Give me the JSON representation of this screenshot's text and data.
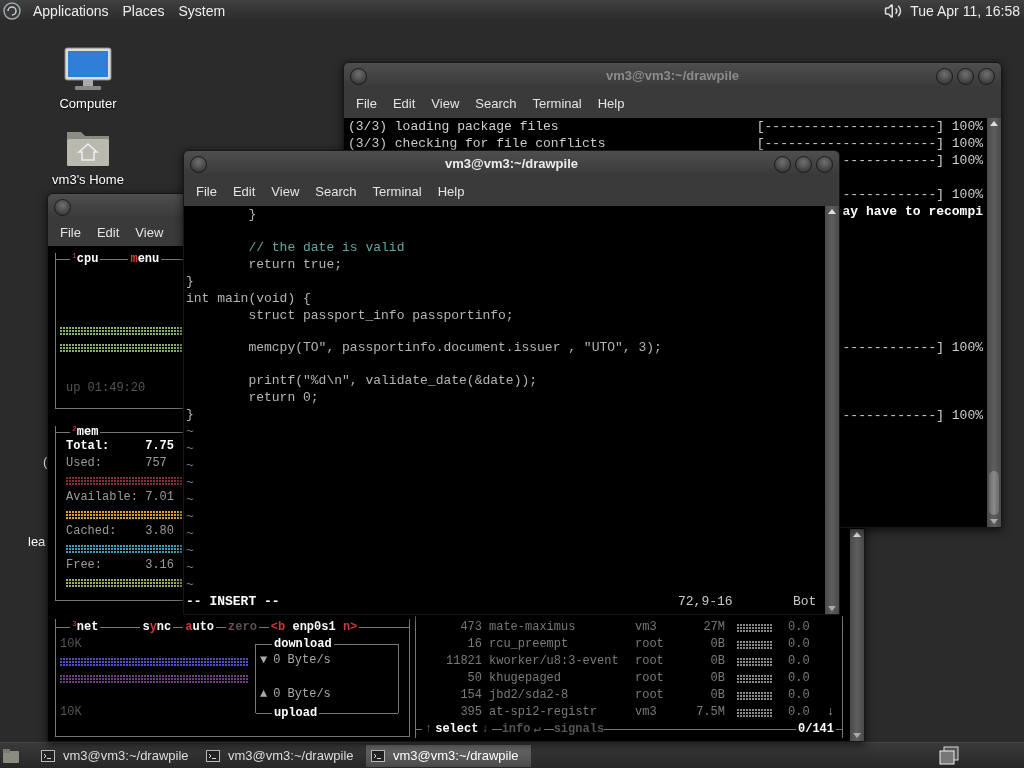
{
  "top_panel": {
    "menus": [
      "Applications",
      "Places",
      "System"
    ],
    "clock": "Tue Apr 11, 16:58"
  },
  "desktop": {
    "icons": [
      {
        "kind": "computer",
        "label": "Computer"
      },
      {
        "kind": "home",
        "label": "vm3's Home"
      }
    ],
    "partial_labels": [
      "(",
      "lea"
    ]
  },
  "btop_window": {
    "menu": [
      "File",
      "Edit",
      "View"
    ],
    "cpu_box": {
      "number": "1",
      "title": "cpu",
      "menu_segments": [
        {
          "kind": "key",
          "text": "m"
        },
        {
          "kind": "plain",
          "text": "enu"
        }
      ],
      "uptime": "up 01:49:20"
    },
    "mem_box": {
      "number": "2",
      "title": "mem",
      "rows": [
        {
          "kind": "total",
          "text": "Total:     7.75"
        },
        {
          "kind": "value",
          "text": "Used:      757"
        },
        {
          "kind": "bar",
          "color": "#7c3434"
        },
        {
          "kind": "value",
          "text": "Available: 7.01"
        },
        {
          "kind": "bar",
          "color": "#d8a630"
        },
        {
          "kind": "value",
          "text": "Cached:    3.80"
        },
        {
          "kind": "bar",
          "color": "#3f9fc0"
        },
        {
          "kind": "value",
          "text": "Free:      3.16"
        },
        {
          "kind": "bar",
          "color": "#9ab060"
        }
      ]
    },
    "net_box": {
      "number": "3",
      "title": "net",
      "options": [
        {
          "disabled": false,
          "segments": [
            {
              "kind": "plain",
              "text": "s"
            },
            {
              "kind": "key",
              "text": "y"
            },
            {
              "kind": "plain",
              "text": "nc"
            }
          ]
        },
        {
          "disabled": false,
          "segments": [
            {
              "kind": "key",
              "text": "a"
            },
            {
              "kind": "plain",
              "text": "uto"
            }
          ]
        },
        {
          "disabled": true,
          "segments": [
            {
              "kind": "key",
              "text": "z"
            },
            {
              "kind": "plain",
              "text": "ero"
            }
          ]
        },
        {
          "disabled": false,
          "segments": [
            {
              "kind": "key",
              "text": "<b"
            },
            {
              "kind": "plain",
              "text": " enp0s1 "
            },
            {
              "kind": "key",
              "text": "n>"
            }
          ]
        }
      ],
      "scale_top": "10K",
      "scale_bottom": "10K",
      "download": {
        "title": "download",
        "arrow": "▼",
        "rate": "0 Byte/s"
      },
      "upload": {
        "title": "upload",
        "arrow": "▲",
        "rate": "0 Byte/s"
      }
    },
    "proc_box": {
      "rows": [
        {
          "pid": "473",
          "name": "mate-maximus",
          "user": "vm3",
          "mem": "27M",
          "cpu": "0.0"
        },
        {
          "pid": "16",
          "name": "rcu_preempt",
          "user": "root",
          "mem": "0B",
          "cpu": "0.0"
        },
        {
          "pid": "11821",
          "name": "kworker/u8:3-event",
          "user": "root",
          "mem": "0B",
          "cpu": "0.0"
        },
        {
          "pid": "50",
          "name": "khugepaged",
          "user": "root",
          "mem": "0B",
          "cpu": "0.0"
        },
        {
          "pid": "154",
          "name": "jbd2/sda2-8",
          "user": "root",
          "mem": "0B",
          "cpu": "0.0"
        },
        {
          "pid": "395",
          "name": "at-spi2-registr",
          "user": "vm3",
          "mem": "7.5M",
          "cpu": "0.0"
        }
      ],
      "scroll_marker": "↓",
      "footer": [
        {
          "kind": "arrow",
          "text": "↑"
        },
        {
          "kind": "label",
          "text": "select"
        },
        {
          "kind": "arrow",
          "text": "↓"
        },
        {
          "kind": "gap"
        },
        {
          "kind": "dim",
          "text": "info"
        },
        {
          "kind": "arrow",
          "text": "↵"
        },
        {
          "kind": "gap"
        },
        {
          "kind": "dim",
          "text": "signals"
        }
      ],
      "count": "0/141"
    }
  },
  "back_terminal": {
    "title": "vm3@vm3:~/drawpile",
    "active": false,
    "menu": [
      "File",
      "Edit",
      "View",
      "Search",
      "Terminal",
      "Help"
    ],
    "lines": [
      {
        "text": "(3/3) loading package files",
        "progress": "[----------------------] 100%"
      },
      {
        "text": "(3/3) checking for file conflicts",
        "progress": "[----------------------] 100%"
      }
    ],
    "tail": [
      {
        "kind": "progress",
        "text": "------------] 100%"
      },
      {
        "kind": "blank"
      },
      {
        "kind": "progress",
        "text": "------------] 100%"
      },
      {
        "kind": "bold",
        "text": "ay have to recompi"
      },
      {
        "kind": "blank"
      },
      {
        "kind": "blank"
      },
      {
        "kind": "blank"
      },
      {
        "kind": "blank"
      },
      {
        "kind": "blank"
      },
      {
        "kind": "blank"
      },
      {
        "kind": "blank"
      },
      {
        "kind": "progress",
        "text": "------------] 100%"
      },
      {
        "kind": "blank"
      },
      {
        "kind": "blank"
      },
      {
        "kind": "blank"
      },
      {
        "kind": "progress",
        "text": "------------] 100%"
      }
    ]
  },
  "front_terminal": {
    "title": "vm3@vm3:~/drawpile",
    "active": true,
    "menu": [
      "File",
      "Edit",
      "View",
      "Search",
      "Terminal",
      "Help"
    ],
    "lines": [
      {
        "kind": "code",
        "text": "        }"
      },
      {
        "kind": "blank"
      },
      {
        "kind": "comment",
        "text": "        // the date is valid"
      },
      {
        "kind": "code",
        "text": "        return true;"
      },
      {
        "kind": "code",
        "text": "}"
      },
      {
        "kind": "code",
        "text": "int main(void) {"
      },
      {
        "kind": "code",
        "text": "        struct passport_info passportinfo;"
      },
      {
        "kind": "blank"
      },
      {
        "kind": "code",
        "text": "        memcpy(TO\", passportinfo.document.issuer , \"UTO\", 3);"
      },
      {
        "kind": "blank"
      },
      {
        "kind": "code",
        "text": "        printf(\"%d\\n\", validate_date(&date));"
      },
      {
        "kind": "code",
        "text": "        return 0;"
      },
      {
        "kind": "code",
        "text": "}"
      },
      {
        "kind": "tilde",
        "text": "~"
      },
      {
        "kind": "tilde",
        "text": "~"
      },
      {
        "kind": "tilde",
        "text": "~"
      },
      {
        "kind": "tilde",
        "text": "~"
      },
      {
        "kind": "tilde",
        "text": "~"
      },
      {
        "kind": "tilde",
        "text": "~"
      },
      {
        "kind": "tilde",
        "text": "~"
      },
      {
        "kind": "tilde",
        "text": "~"
      },
      {
        "kind": "tilde",
        "text": "~"
      },
      {
        "kind": "tilde",
        "text": "~"
      }
    ],
    "status": {
      "mode": "-- INSERT --",
      "position": "72,9-16",
      "scroll": "Bot"
    }
  },
  "taskbar": {
    "buttons": [
      {
        "label": "vm3@vm3:~/drawpile",
        "selected": false
      },
      {
        "label": "vm3@vm3:~/drawpile",
        "selected": false
      },
      {
        "label": "vm3@vm3:~/drawpile",
        "selected": true
      }
    ]
  }
}
